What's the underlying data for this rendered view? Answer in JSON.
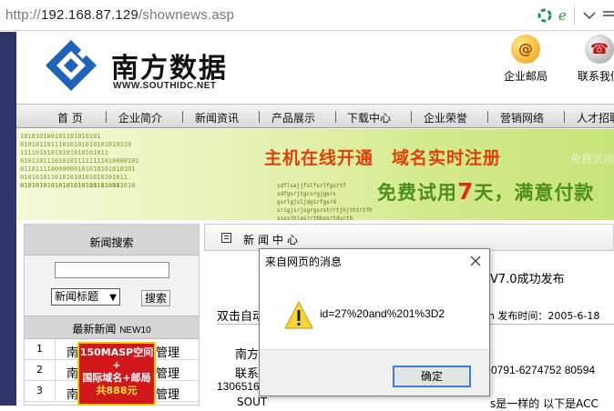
{
  "browser": {
    "url_scheme": "http://",
    "url_host": "192.168.87.129",
    "url_path": "/shownews.asp"
  },
  "header": {
    "logo_cn": "南方数据",
    "logo_en": "WWW.SOUTHIDC.NET",
    "links": [
      {
        "label": "企业邮局",
        "icon": "email-icon"
      },
      {
        "label": "联系我们",
        "icon": "contact-icon"
      }
    ]
  },
  "nav": {
    "items": [
      "首 页",
      "企业简介",
      "新闻资讯",
      "产品展示",
      "下载中心",
      "企业荣誉",
      "营销网络",
      "人才招聘"
    ]
  },
  "banner": {
    "binary": "101010100101101010101\n01010110111010101010101010110\n11110101010101010101011\n0101101110101011111111010000101\n011011110000000101010101010101\n0101010110101010101010101011\n010101010101010101111010011",
    "binary_tail": "010101010101010101001110101010",
    "headline_1": "主机在线开通",
    "headline_2": "域名实时注册",
    "headline_tag": "免费试用",
    "code_lines": "sdflsajjfslfsrlfgsrtf\nsdfgsrjtgcsrgjgsrs\ngsrlgjsljdgsrfgsrd\nsrigjsrjsgrgsrstrrtjhjthtrtfh\nsssyjhjgsjrthhgsrtdyrth",
    "slogan_pre": "免费试用",
    "slogan_num": "7",
    "slogan_post": "天，满意付款"
  },
  "left": {
    "search_title": "新闻搜索",
    "search_select_value": "新闻标题",
    "search_button": "搜索",
    "latest_title": "最新新闻",
    "latest_sub": "NEW10",
    "rows": [
      {
        "num": "1",
        "pre": "南",
        "post": "管理"
      },
      {
        "num": "2",
        "pre": "南",
        "post": "管理"
      },
      {
        "num": "3",
        "pre": "南",
        "post": "管理"
      }
    ],
    "ad_line1": "150MASP空间",
    "ad_line2": "+",
    "ad_line3": "国际域名+邮局",
    "ad_line4": "共888元"
  },
  "right": {
    "title": "新闻中心",
    "headline": "V7.0成功发布",
    "meta_left": "双击自动",
    "meta_right": "qun 发布时间：2005-6-18",
    "p1": "南方",
    "p2": "联系",
    "p2_right": "0791-6274752  80594",
    "p3": "1306516",
    "p4": "SOUT",
    "p4_right": "s是一样的 以下是ACC"
  },
  "dialog": {
    "title": "来自网页的消息",
    "message": "id=27%20and%201%3D2",
    "ok": "确定"
  },
  "colors": {
    "stripe": "#2f3468",
    "headline": "#e0400a",
    "slogan": "#4e8f1c",
    "dialog_focus": "#3c7fd6"
  }
}
